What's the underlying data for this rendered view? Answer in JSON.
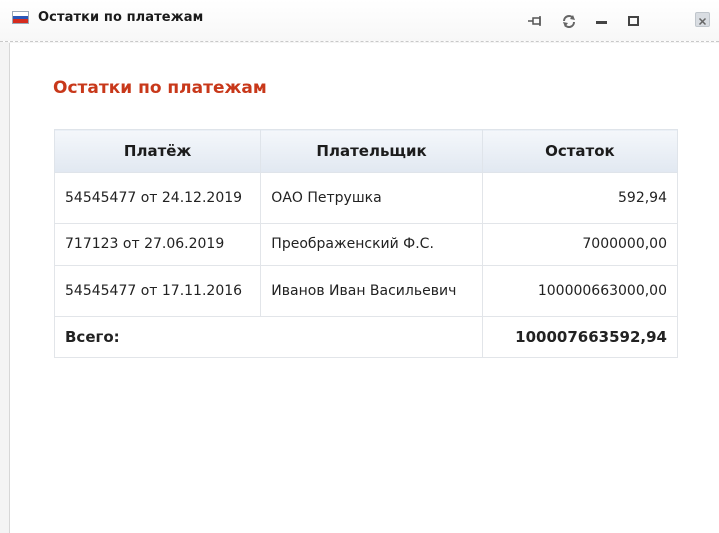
{
  "window": {
    "title": "Остатки по платежам"
  },
  "main": {
    "heading": "Остатки по платежам",
    "table": {
      "headers": [
        "Платёж",
        "Плательщик",
        "Остаток"
      ],
      "rows": [
        [
          "54545477 от 24.12.2019",
          "ОАО Петрушка",
          "592,94"
        ],
        [
          "717123 от 27.06.2019",
          "Преображенский Ф.С.",
          "7000000,00"
        ],
        [
          "54545477 от 17.11.2016",
          "Иванов Иван Васильевич",
          "100000663000,00"
        ]
      ],
      "total_label": "Всего:",
      "total_value": "100007663592,94"
    }
  },
  "icons": [
    "app-icon",
    "pin-icon",
    "refresh-icon",
    "minimize-icon",
    "maximize-icon",
    "close-icon"
  ],
  "colors": {
    "heading": "#c8381a",
    "header_bg": "#e6ecf3"
  }
}
